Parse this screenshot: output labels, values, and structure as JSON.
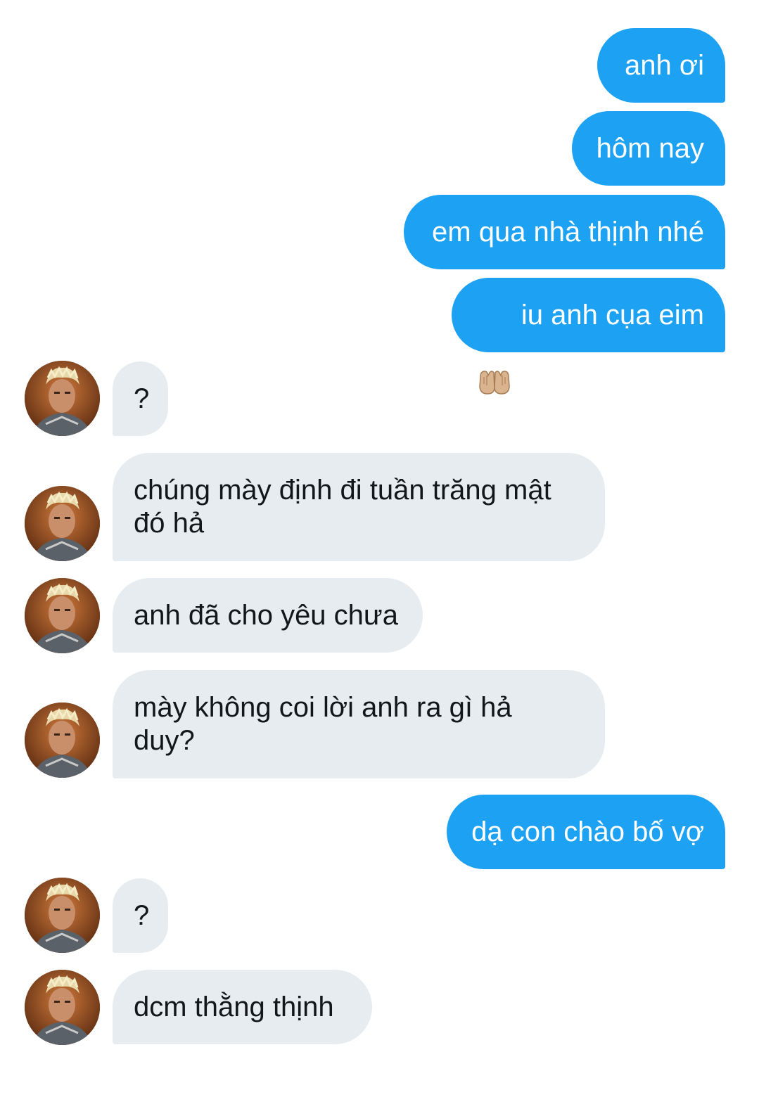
{
  "messages": [
    {
      "id": "m1",
      "direction": "outgoing",
      "text": "anh ơi"
    },
    {
      "id": "m2",
      "direction": "outgoing",
      "text": "hôm nay"
    },
    {
      "id": "m3",
      "direction": "outgoing",
      "text": "em qua nhà thịnh nhé"
    },
    {
      "id": "m4",
      "direction": "outgoing",
      "emoji": "palms-up-together-icon",
      "text": "iu anh cụa eim"
    },
    {
      "id": "m5",
      "direction": "incoming",
      "text": "?"
    },
    {
      "id": "m6",
      "direction": "incoming",
      "text": "chúng mày định đi tuần trăng mật\nđó hả"
    },
    {
      "id": "m7",
      "direction": "incoming",
      "text": "anh đã cho yêu chưa"
    },
    {
      "id": "m8",
      "direction": "incoming",
      "text": "mày không coi lời anh ra gì hả\nduy?"
    },
    {
      "id": "m9",
      "direction": "outgoing",
      "text": "dạ con chào bố vợ"
    },
    {
      "id": "m10",
      "direction": "incoming",
      "text": "?"
    },
    {
      "id": "m11",
      "direction": "incoming",
      "text": "dcm thằng thịnh"
    }
  ],
  "colors": {
    "outgoing_bubble": "#1da1f2",
    "incoming_bubble": "#e6ecf0",
    "outgoing_text": "#ffffff",
    "incoming_text": "#14171a"
  }
}
